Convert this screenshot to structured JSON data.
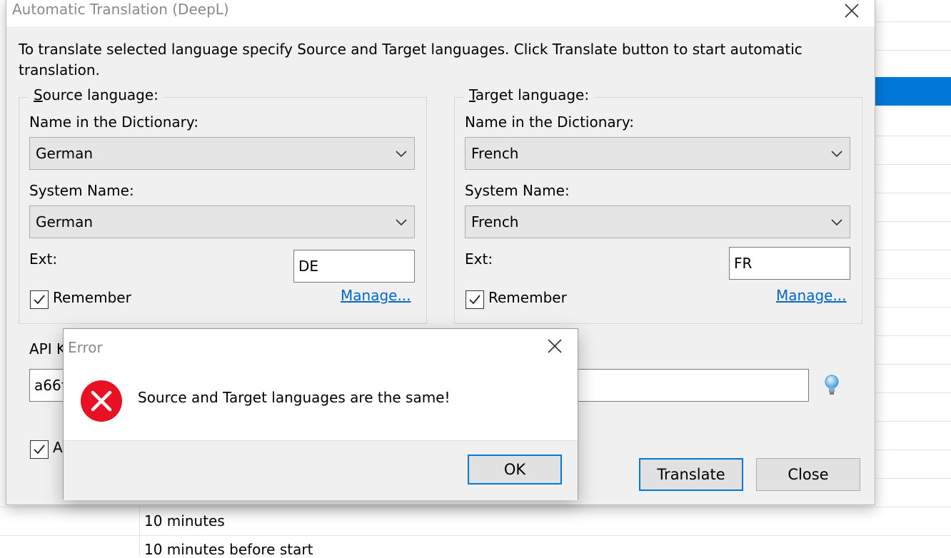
{
  "background": {
    "rows": [
      "10 minutes",
      "10 minutes before start"
    ],
    "selection_color": "#0078d7"
  },
  "dialog": {
    "title": "Automatic Translation (DeepL)",
    "description": "To translate selected language specify Source and Target languages. Click Translate button to start automatic translation.",
    "source": {
      "legend_accel": "S",
      "legend_rest": "ource language:",
      "dict_label": "Name in the Dictionary:",
      "dict_value": "German",
      "system_label": "System Name:",
      "system_value": "German",
      "ext_label": "Ext:",
      "ext_value": "DE",
      "remember_label": "Remember",
      "remember_checked": true,
      "manage_link": "Manage..."
    },
    "target": {
      "legend_accel": "T",
      "legend_rest": "arget language:",
      "dict_label": "Name in the Dictionary:",
      "dict_value": "French",
      "system_label": "System Name:",
      "system_value": "French",
      "ext_label": "Ext:",
      "ext_value": "FR",
      "remember_label": "Remember",
      "remember_checked": true,
      "manage_link": "Manage..."
    },
    "api_key_label_partial": "API K",
    "api_key_value_partial": "a66f",
    "bottom_checkbox_label_partial": "A",
    "bottom_checkbox_checked": true,
    "translate_button": "Translate",
    "close_button": "Close"
  },
  "error_dialog": {
    "title": "Error",
    "message": "Source and Target languages are the same!",
    "ok_button": "OK",
    "icon": "error-icon",
    "icon_color": "#e81123"
  },
  "colors": {
    "accent": "#0078d7",
    "link": "#0066cc"
  }
}
